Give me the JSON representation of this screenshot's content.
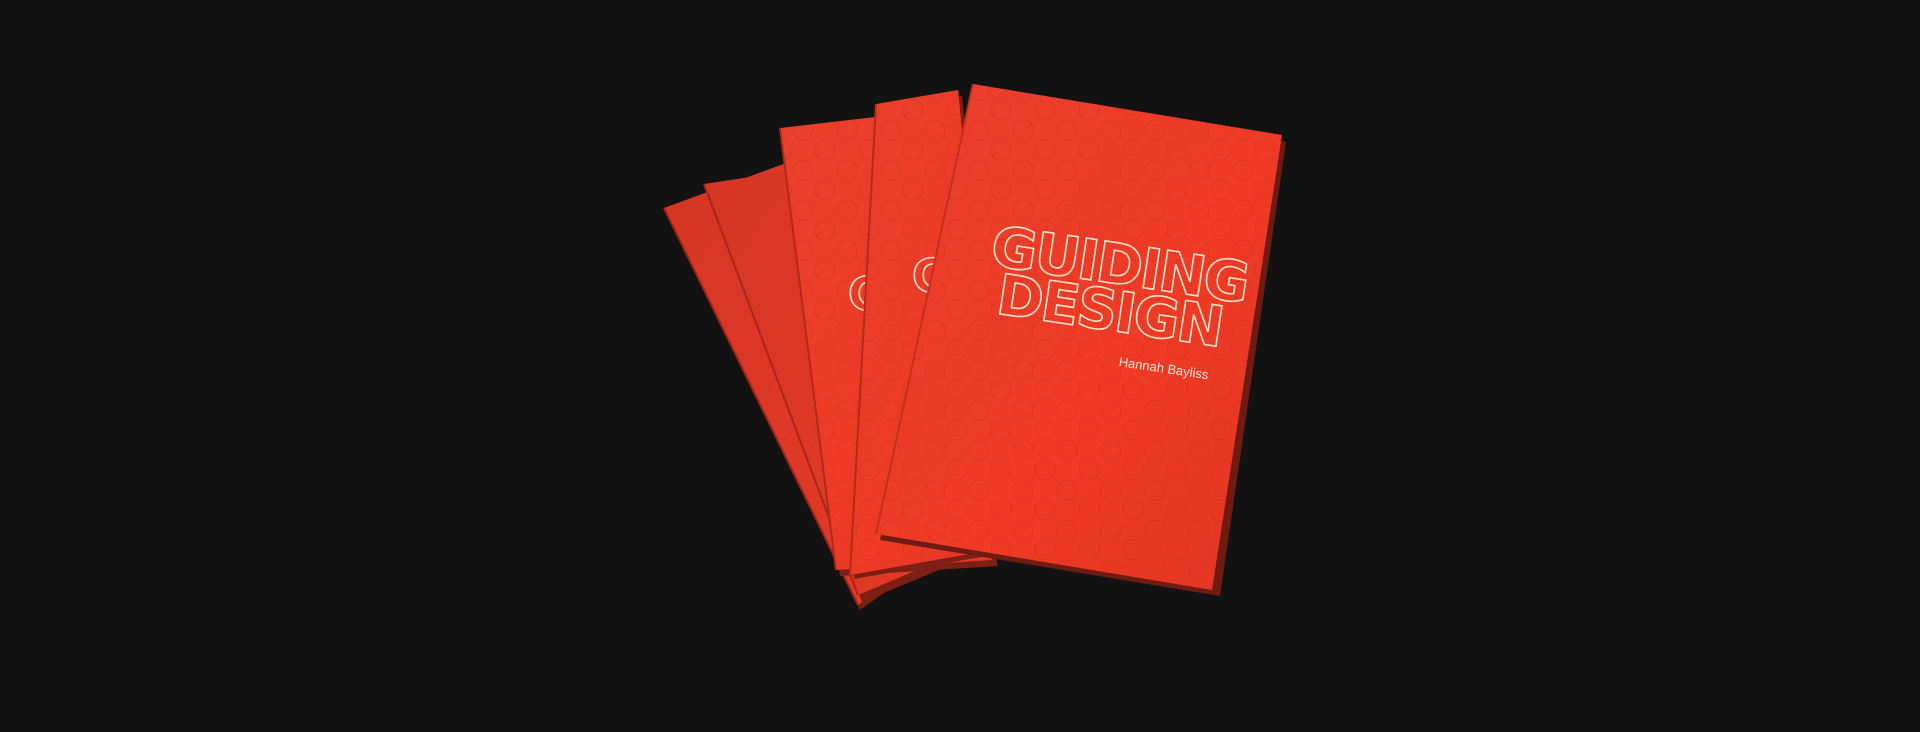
{
  "photo": {
    "background_color": "#121212",
    "booklet_color": "#ea3a26",
    "booklet_count": 5
  },
  "front_cover": {
    "title_line_1": "GUIDING",
    "title_line_2": "DESIGN",
    "author": "Hannah Bayliss",
    "title_stroke_color": "#f3e3c8"
  }
}
